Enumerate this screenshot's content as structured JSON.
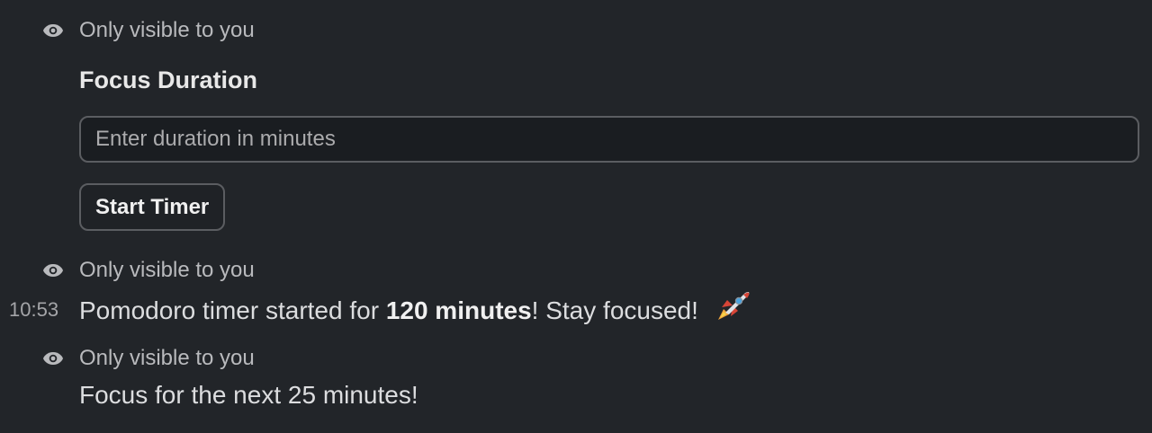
{
  "visibility_note": "Only visible to you",
  "form": {
    "heading": "Focus Duration",
    "input_value": "",
    "input_placeholder": "Enter duration in minutes",
    "button_label": "Start Timer"
  },
  "message_started": {
    "timestamp": "10:53",
    "text_before": "Pomodoro timer started for ",
    "bold_text": "120 minutes",
    "text_after": "! Stay focused!",
    "emoji_icon": "rocket-icon"
  },
  "message_focus": {
    "text": "Focus for the next 25 minutes!"
  },
  "icons": {
    "visibility": "eye-icon"
  }
}
